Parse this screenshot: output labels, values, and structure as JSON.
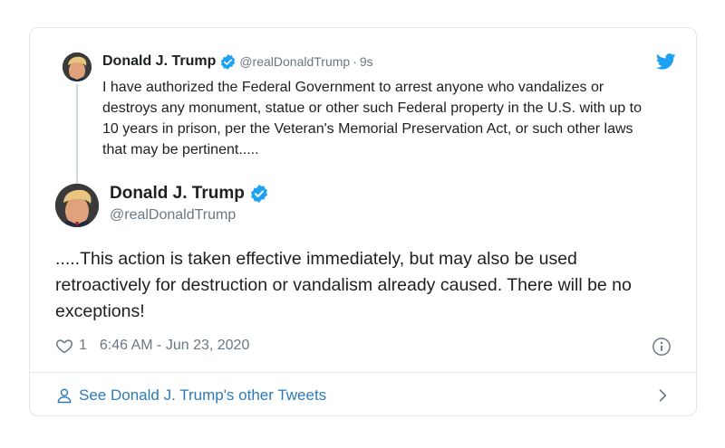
{
  "reply_tweet": {
    "name": "Donald J. Trump",
    "handle": "@realDonaldTrump",
    "separator": "·",
    "time": "9s",
    "text": "I have authorized the Federal Government to arrest anyone who vandalizes or destroys any monument, statue or other such Federal property in the U.S. with up to 10 years in prison, per the Veteran's Memorial Preservation Act, or such other laws that may be pertinent....."
  },
  "main_tweet": {
    "name": "Donald J. Trump",
    "handle": "@realDonaldTrump",
    "text": ".....This action is taken effective immediately, but may also be used retroactively for destruction or vandalism already caused. There will be no exceptions!",
    "like_count": "1",
    "timestamp": "6:46 AM - Jun 23, 2020"
  },
  "footer": {
    "label": "See Donald J. Trump's other Tweets"
  },
  "icons": {
    "brand": "twitter-bird-icon",
    "verified": "verified-badge-icon",
    "like": "heart-icon",
    "info": "info-icon",
    "profile": "person-icon",
    "more": "chevron-right-icon"
  },
  "colors": {
    "brand_blue": "#1da1f2",
    "link_blue": "#2b7bb9",
    "text": "#1c2022",
    "muted": "#697882",
    "border": "#e1e8ed"
  }
}
